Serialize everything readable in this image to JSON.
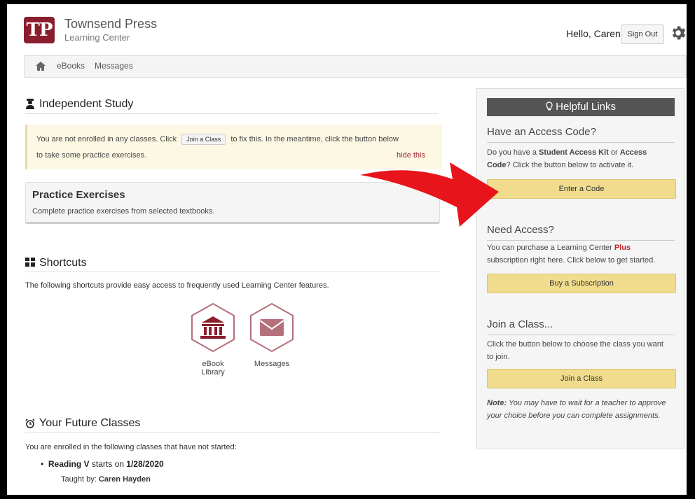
{
  "header": {
    "logo_text": "TP",
    "brand_name": "Townsend Press",
    "brand_sub": "Learning Center",
    "greeting": "Hello, Caren",
    "signout_label": "Sign Out"
  },
  "nav": {
    "items": [
      {
        "label": "eBooks"
      },
      {
        "label": "Messages"
      }
    ]
  },
  "independent_study": {
    "title": "Independent Study",
    "notice_pre": "You are not enrolled in any classes. Click",
    "notice_button": "Join a Class",
    "notice_post": "to fix this. In the meantime, click the button below",
    "notice_line2": "to take some practice exercises.",
    "hide_label": "hide this"
  },
  "practice": {
    "title": "Practice Exercises",
    "subtitle": "Complete practice exercises from selected textbooks."
  },
  "shortcuts": {
    "title": "Shortcuts",
    "description": "The following shortcuts provide easy access to frequently used Learning Center features.",
    "items": [
      {
        "label_line1": "eBook",
        "label_line2": "Library",
        "icon": "library-icon"
      },
      {
        "label_line1": "Messages",
        "label_line2": "",
        "icon": "envelope-icon"
      }
    ]
  },
  "future_classes": {
    "title": "Your Future Classes",
    "description": "You are enrolled in the following classes that have not started:",
    "classes": [
      {
        "name": "Reading V",
        "starts_text": "starts on",
        "date": "1/28/2020",
        "taught_by_label": "Taught by:",
        "teacher": "Caren Hayden"
      }
    ]
  },
  "helpful_links": {
    "header": "Helpful Links",
    "access_code": {
      "title": "Have an Access Code?",
      "text_1": "Do you have a ",
      "bold_1": "Student Access Kit",
      "text_2": " or ",
      "bold_2": "Access",
      "bold_3": "Code",
      "text_3": "? Click the button below to activate it.",
      "button": "Enter a Code"
    },
    "need_access": {
      "title": "Need Access?",
      "text_1": "You can purchase a Learning Center ",
      "plus": "Plus",
      "text_2": "subscription right here. Click below to get started.",
      "button": "Buy a Subscription"
    },
    "join_class": {
      "title": "Join a Class...",
      "text_1": "Click the button below to choose the class you want",
      "text_2": "to join.",
      "button": "Join a Class"
    },
    "note_label": "Note:",
    "note_text": " You may have to wait for a teacher to approve your choice before you can complete assignments."
  },
  "colors": {
    "brand": "#8b1e2d",
    "button_yellow": "#f0dc8c",
    "icon_rose": "#b5707c",
    "arrow_red": "#e8141b"
  }
}
